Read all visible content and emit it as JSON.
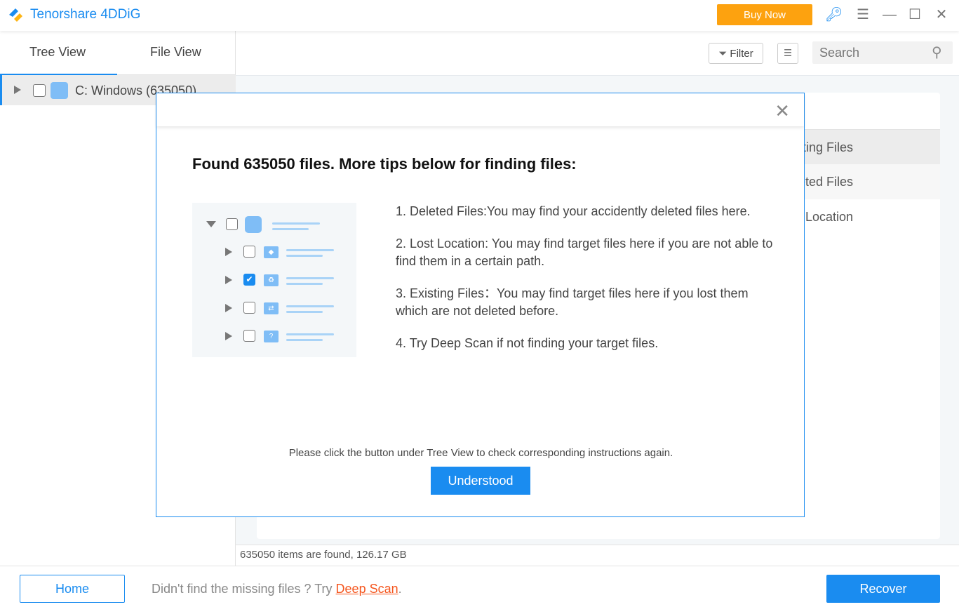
{
  "app": {
    "title": "Tenorshare 4DDiG",
    "buy_now": "Buy Now"
  },
  "sidebar": {
    "tabs": [
      {
        "label": "Tree View",
        "active": true
      },
      {
        "label": "File View"
      }
    ],
    "tree": [
      {
        "label": "C: Windows (635050)"
      }
    ]
  },
  "toolbar": {
    "filter": "Filter",
    "search_placeholder": "Search"
  },
  "panel": {
    "rows": [
      "Existing Files",
      "Deleted Files",
      "Lost Location"
    ]
  },
  "status": "635050 items are found, 126.17 GB",
  "footer": {
    "home": "Home",
    "hint_prefix": "Didn't find the missing files ? Try ",
    "deep_scan": "Deep Scan",
    "hint_suffix": ".",
    "recover": "Recover"
  },
  "modal": {
    "title": "Found 635050 files. More tips below for finding files:",
    "tips": [
      "1. Deleted Files:You may find your accidently deleted files here.",
      "2. Lost Location: You may find target files here if you are not able to find them in a certain path.",
      "3. Existing Files：You may find target files here if you lost them which are not deleted before.",
      "4. Try Deep Scan if not finding your target files."
    ],
    "note": "Please click the button under Tree View to check corresponding instructions again.",
    "button": "Understood"
  },
  "colors": {
    "accent": "#1a8cf0",
    "buy": "#fda20f",
    "deep_scan": "#f5561e"
  }
}
